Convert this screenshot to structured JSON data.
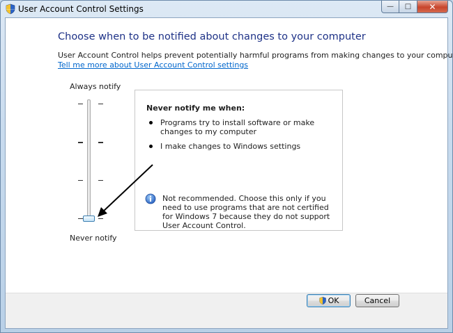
{
  "window": {
    "title": "User Account Control Settings",
    "controls": {
      "minimize": "—",
      "maximize": "□",
      "close": "✕"
    }
  },
  "main": {
    "heading": "Choose when to be notified about changes to your computer",
    "description": "User Account Control helps prevent potentially harmful programs from making changes to your computer.",
    "link": "Tell me more about User Account Control settings"
  },
  "slider": {
    "top_label": "Always notify",
    "bottom_label": "Never notify",
    "levels": 4,
    "selected_level": 1
  },
  "panel": {
    "title": "Never notify me when:",
    "bullets": [
      "Programs try to install software or make changes to my computer",
      "I make changes to Windows settings"
    ],
    "note": "Not recommended. Choose this only if you need to use programs that are not certified for Windows 7 because they do not support User Account Control."
  },
  "buttons": {
    "ok": "OK",
    "cancel": "Cancel"
  },
  "colors": {
    "heading": "#1e3287",
    "link": "#0066cc",
    "accent": "#3c7fb1"
  },
  "icons": {
    "title": "uac-shield-icon",
    "note": "info-icon",
    "ok": "uac-shield-icon"
  }
}
